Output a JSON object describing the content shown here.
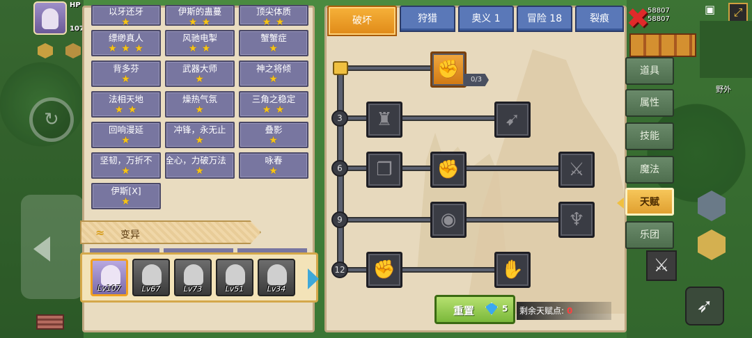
{
  "hud": {
    "hp_label": "HP",
    "level_text": "107",
    "money1": "58807",
    "money2": "58807"
  },
  "minimap": {
    "label": "野外"
  },
  "talent_list": {
    "rows": [
      [
        {
          "name": "以牙还牙",
          "stars": "★"
        },
        {
          "name": "伊斯的蛊蔓",
          "stars": "★ ★"
        },
        {
          "name": "顶尖体质",
          "stars": "★ ★"
        }
      ],
      [
        {
          "name": "缥缈真人",
          "stars": "★ ★ ★"
        },
        {
          "name": "风驰电掣",
          "stars": "★ ★"
        },
        {
          "name": "蟹蟹症",
          "stars": "★"
        }
      ],
      [
        {
          "name": "背多芬",
          "stars": "★"
        },
        {
          "name": "武器大师",
          "stars": "★"
        },
        {
          "name": "神之将倾",
          "stars": "★"
        }
      ],
      [
        {
          "name": "法相天地",
          "stars": "★ ★"
        },
        {
          "name": "燥热气氛",
          "stars": "★"
        },
        {
          "name": "三角之稳定",
          "stars": "★ ★"
        }
      ],
      [
        {
          "name": "回响漫延",
          "stars": "★"
        },
        {
          "name": "冲锋，永无止",
          "stars": "★"
        },
        {
          "name": "叠影",
          "stars": "★"
        }
      ],
      [
        {
          "name": "坚韧，万折不",
          "stars": "★"
        },
        {
          "name": "全心，力破万法",
          "stars": "★"
        },
        {
          "name": "咏春",
          "stars": "★"
        }
      ],
      [
        {
          "name": "伊斯[X]",
          "stars": "★"
        }
      ]
    ],
    "category": "变异"
  },
  "heroes": [
    {
      "level": "Lv107"
    },
    {
      "level": "Lv67"
    },
    {
      "level": "Lv73"
    },
    {
      "level": "Lv51"
    },
    {
      "level": "Lv34"
    }
  ],
  "tabs": [
    {
      "label": "破坏"
    },
    {
      "label": "狩猎"
    },
    {
      "label": "奥义 1"
    },
    {
      "label": "冒险 18"
    },
    {
      "label": "裂痕"
    }
  ],
  "tree": {
    "root_count": "0/3",
    "tiers": [
      "3",
      "6",
      "9",
      "12"
    ]
  },
  "reset": {
    "label": "重置",
    "cost": "5"
  },
  "points": {
    "label": "剩余天赋点:",
    "value": "0"
  },
  "side_menu": [
    {
      "label": "道具"
    },
    {
      "label": "属性"
    },
    {
      "label": "技能"
    },
    {
      "label": "魔法"
    },
    {
      "label": "天赋"
    },
    {
      "label": "乐团"
    }
  ],
  "icons": {
    "close": "close-icon",
    "gem": "gem-icon",
    "dna": "dna-icon"
  }
}
